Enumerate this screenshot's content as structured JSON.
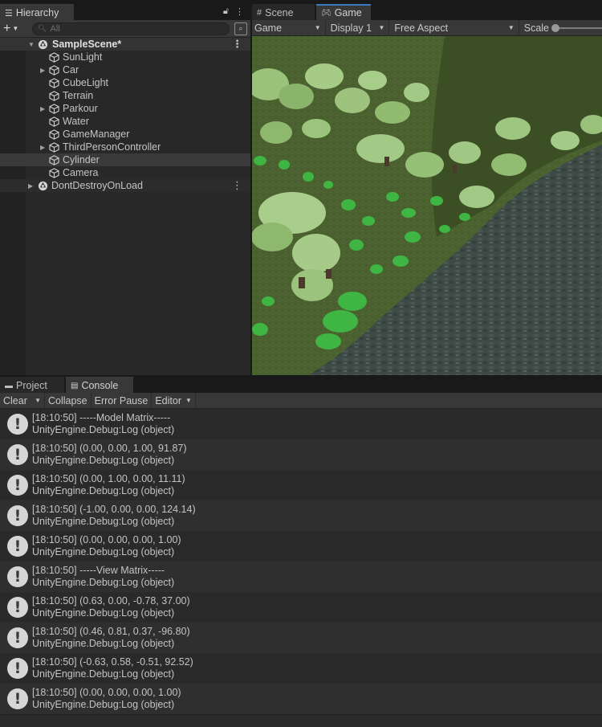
{
  "hierarchy": {
    "tab_label": "Hierarchy",
    "search_placeholder": "All",
    "scene": "SampleScene*",
    "items": [
      {
        "label": "SunLight",
        "expandable": false
      },
      {
        "label": "Car",
        "expandable": true
      },
      {
        "label": "CubeLight",
        "expandable": false
      },
      {
        "label": "Terrain",
        "expandable": false
      },
      {
        "label": "Parkour",
        "expandable": true
      },
      {
        "label": "Water",
        "expandable": false
      },
      {
        "label": "GameManager",
        "expandable": false
      },
      {
        "label": "ThirdPersonController",
        "expandable": true
      },
      {
        "label": "Cylinder",
        "expandable": false,
        "selected": true
      },
      {
        "label": "Camera",
        "expandable": false
      }
    ],
    "dont_destroy": "DontDestroyOnLoad"
  },
  "game": {
    "tabs": [
      {
        "label": "Scene",
        "icon": "grid-icon"
      },
      {
        "label": "Game",
        "icon": "gamepad-icon",
        "active": true
      }
    ],
    "toolbar": {
      "view_mode": "Game",
      "display": "Display 1",
      "aspect": "Free Aspect",
      "scale_label": "Scale"
    }
  },
  "console": {
    "tabs": [
      {
        "label": "Project",
        "icon": "folder-icon"
      },
      {
        "label": "Console",
        "icon": "console-icon",
        "active": true
      }
    ],
    "toolbar": {
      "clear": "Clear",
      "collapse": "Collapse",
      "error_pause": "Error Pause",
      "editor": "Editor"
    },
    "logs": [
      {
        "line1": "[18:10:50] -----Model Matrix-----",
        "line2": "UnityEngine.Debug:Log (object)"
      },
      {
        "line1": "[18:10:50] (0.00, 0.00, 1.00, 91.87)",
        "line2": "UnityEngine.Debug:Log (object)"
      },
      {
        "line1": "[18:10:50] (0.00, 1.00, 0.00, 11.11)",
        "line2": "UnityEngine.Debug:Log (object)"
      },
      {
        "line1": "[18:10:50] (-1.00, 0.00, 0.00, 124.14)",
        "line2": "UnityEngine.Debug:Log (object)"
      },
      {
        "line1": "[18:10:50] (0.00, 0.00, 0.00, 1.00)",
        "line2": "UnityEngine.Debug:Log (object)"
      },
      {
        "line1": "[18:10:50] -----View Matrix-----",
        "line2": "UnityEngine.Debug:Log (object)"
      },
      {
        "line1": "[18:10:50] (0.63, 0.00, -0.78, 37.00)",
        "line2": "UnityEngine.Debug:Log (object)"
      },
      {
        "line1": "[18:10:50] (0.46, 0.81, 0.37, -96.80)",
        "line2": "UnityEngine.Debug:Log (object)"
      },
      {
        "line1": "[18:10:50] (-0.63, 0.58, -0.51, 92.52)",
        "line2": "UnityEngine.Debug:Log (object)"
      },
      {
        "line1": "[18:10:50] (0.00, 0.00, 0.00, 1.00)",
        "line2": "UnityEngine.Debug:Log (object)"
      }
    ]
  },
  "colors": {
    "panel_bg": "#282828",
    "toolbar_bg": "#383838",
    "selection": "#3a3a3a",
    "grass": "#4c6230",
    "rock": "#3c4945"
  }
}
